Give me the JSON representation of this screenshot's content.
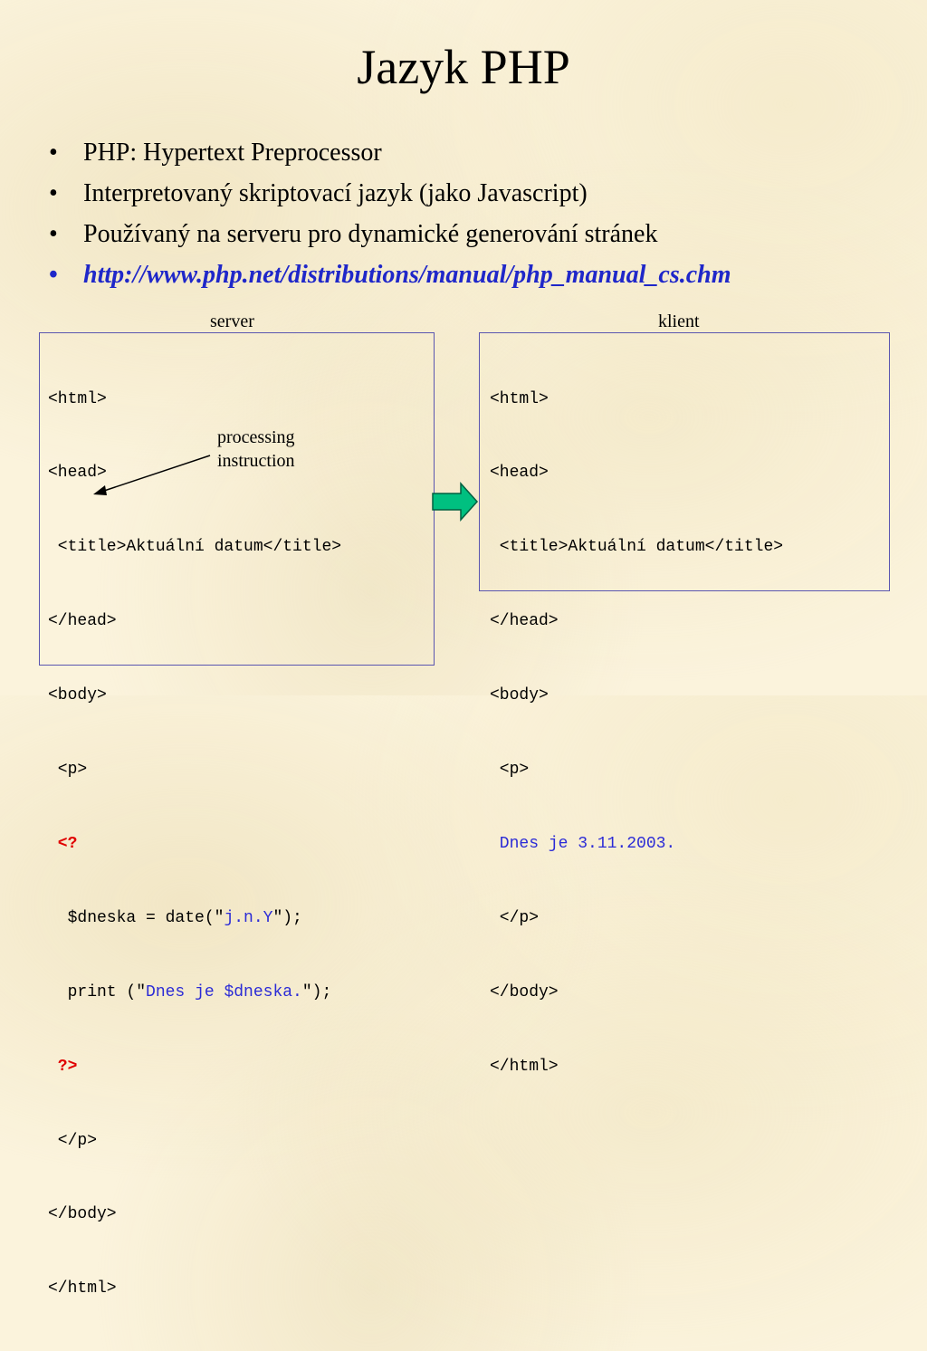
{
  "title": "Jazyk PHP",
  "bullets": [
    "PHP: Hypertext Preprocessor",
    "Interpretovaný skriptovací jazyk (jako Javascript)",
    "Používaný na serveru pro dynamické generování stránek",
    "http://www.php.net/distributions/manual/php_manual_cs.chm"
  ],
  "bullet_glyph": "•",
  "server_label": "server",
  "client_label": "klient",
  "annotation": {
    "line1": "processing",
    "line2": "instruction"
  },
  "server_code": {
    "l1": "<html>",
    "l2": "<head>",
    "l3": " <title>Aktuální datum</title>",
    "l4": "</head>",
    "l5": "<body>",
    "l6": " <p>",
    "l7": " <?",
    "l8a": "  $dneska = date(\"",
    "l8b": "j.n.Y",
    "l8c": "\");",
    "l9a": "  print (\"",
    "l9b": "Dnes je $dneska.",
    "l9c": "\");",
    "l10": " ?>",
    "l11": " </p>",
    "l12": "</body>",
    "l13": "</html>"
  },
  "client_code": {
    "l1": "<html>",
    "l2": "<head>",
    "l3": " <title>Aktuální datum</title>",
    "l4": "</head>",
    "l5": "<body>",
    "l6": " <p>",
    "l7": " Dnes je 3.11.2003.",
    "l8": " </p>",
    "l9": "</body>",
    "l10": "</html>"
  },
  "colors": {
    "link": "#1f27c9",
    "php_tag": "#e00000",
    "string": "#2b2bd6",
    "box_border": "#5a56b0",
    "arrow_fill": "#00c080"
  },
  "icons": {
    "transform_arrow": "right-arrow-icon",
    "pointer_arrow": "pointer-arrow-icon"
  }
}
